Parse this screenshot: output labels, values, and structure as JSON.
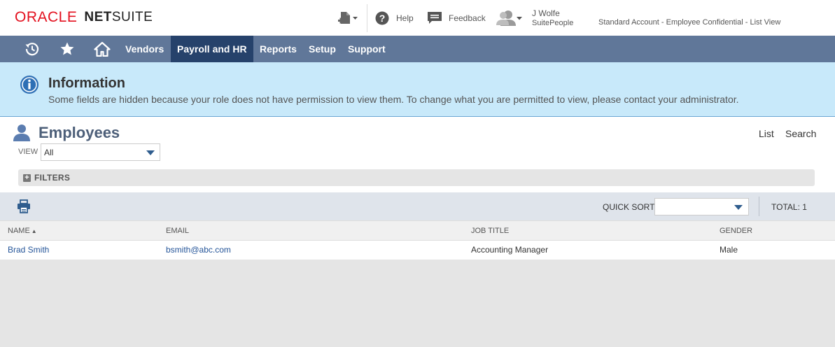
{
  "brand": {
    "oracle": "ORACLE",
    "netsuite_net": "NET",
    "netsuite_suite": "SUITE"
  },
  "header": {
    "help_label": "Help",
    "feedback_label": "Feedback",
    "user_name": "J Wolfe",
    "user_role": "SuitePeople",
    "account_text": "Standard Account - Employee Confidential - List View"
  },
  "nav": {
    "items": [
      {
        "label": "Vendors"
      },
      {
        "label": "Payroll and HR",
        "active": true
      },
      {
        "label": "Reports"
      },
      {
        "label": "Setup"
      },
      {
        "label": "Support"
      }
    ]
  },
  "info": {
    "title": "Information",
    "message": "Some fields are hidden because your role does not have permission to view them. To change what you are permitted to view, please contact your administrator."
  },
  "page": {
    "title": "Employees",
    "list_link": "List",
    "search_link": "Search",
    "view_label": "VIEW",
    "view_value": "All",
    "filters_label": "FILTERS"
  },
  "listbar": {
    "quick_sort_label": "QUICK SORT",
    "quick_sort_value": "",
    "total_label": "TOTAL: 1"
  },
  "table": {
    "columns": [
      "NAME",
      "EMAIL",
      "JOB TITLE",
      "GENDER"
    ],
    "sort_indicator": "▲",
    "rows": [
      {
        "name": "Brad Smith",
        "email": "bsmith@abc.com",
        "job_title": "Accounting Manager",
        "gender": "Male"
      }
    ]
  },
  "colors": {
    "nav_bg": "#607799",
    "nav_active": "#26426b",
    "info_bg": "#c8e9fa",
    "link": "#255599",
    "oracle_red": "#e3101e"
  }
}
